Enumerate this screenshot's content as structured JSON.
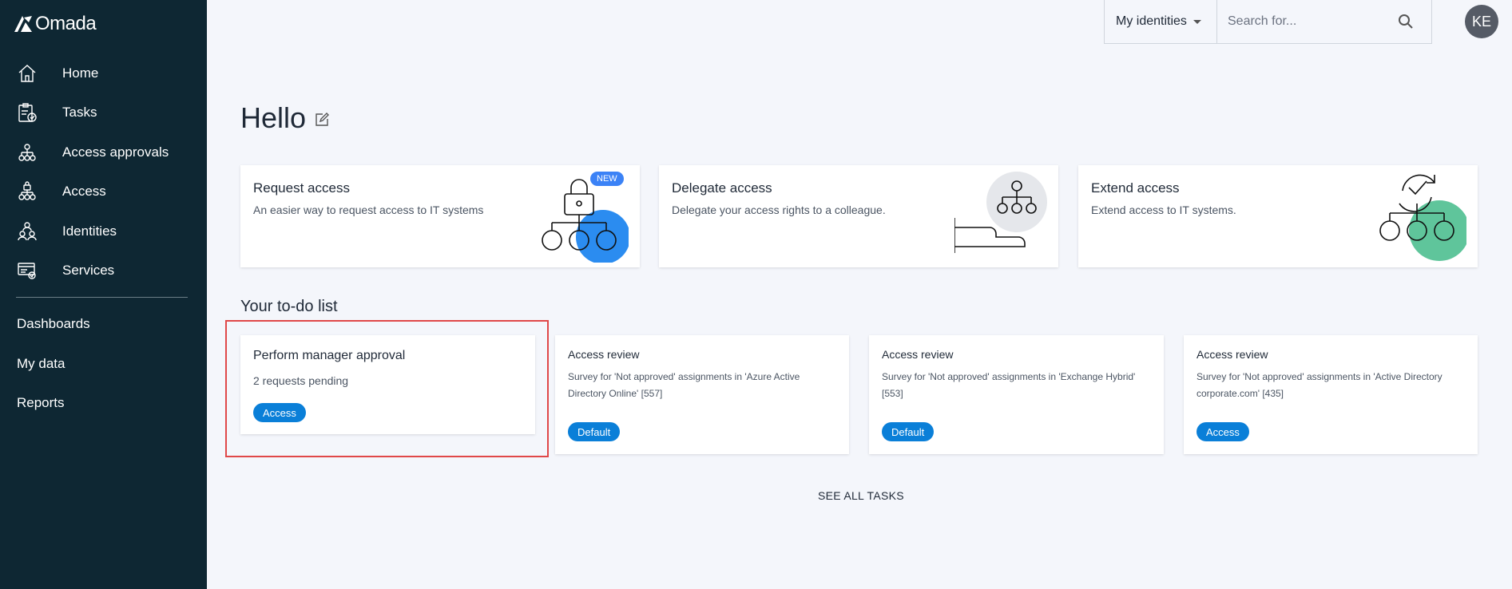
{
  "app": {
    "brand": "Omada"
  },
  "sidebar": {
    "items": [
      {
        "label": "Home",
        "icon": "home-icon"
      },
      {
        "label": "Tasks",
        "icon": "tasks-icon"
      },
      {
        "label": "Access approvals",
        "icon": "access-approvals-icon"
      },
      {
        "label": "Access",
        "icon": "access-icon"
      },
      {
        "label": "Identities",
        "icon": "identities-icon"
      },
      {
        "label": "Services",
        "icon": "services-icon"
      }
    ],
    "links": [
      "Dashboards",
      "My data",
      "Reports"
    ]
  },
  "topbar": {
    "scope": "My identities",
    "search_placeholder": "Search for...",
    "avatar_initials": "KE"
  },
  "greeting": "Hello",
  "action_cards": [
    {
      "title": "Request access",
      "desc": "An easier way to request access to IT systems",
      "badge": "NEW",
      "accent": "#2b8cf0"
    },
    {
      "title": "Delegate access",
      "desc": "Delegate your access rights to a colleague.",
      "accent": "#e5e7eb"
    },
    {
      "title": "Extend access",
      "desc": "Extend access to IT systems.",
      "accent": "#5fc59b"
    }
  ],
  "todo": {
    "title": "Your to-do list",
    "cards": [
      {
        "title": "Perform manager approval",
        "desc": "2 requests pending",
        "tag": "Access"
      },
      {
        "title": "Access review",
        "desc": "Survey for 'Not approved' assignments in 'Azure Active Directory Online' [557]",
        "tag": "Default"
      },
      {
        "title": "Access review",
        "desc": "Survey for 'Not approved' assignments in 'Exchange Hybrid' [553]",
        "tag": "Default"
      },
      {
        "title": "Access review",
        "desc": "Survey for 'Not approved' assignments in 'Active Directory corporate.com' [435]",
        "tag": "Access"
      }
    ],
    "see_all": "SEE ALL TASKS"
  },
  "colors": {
    "sidebar_bg": "#0e2733",
    "pill_blue": "#0a7fd8",
    "highlight_red": "#e04848"
  }
}
